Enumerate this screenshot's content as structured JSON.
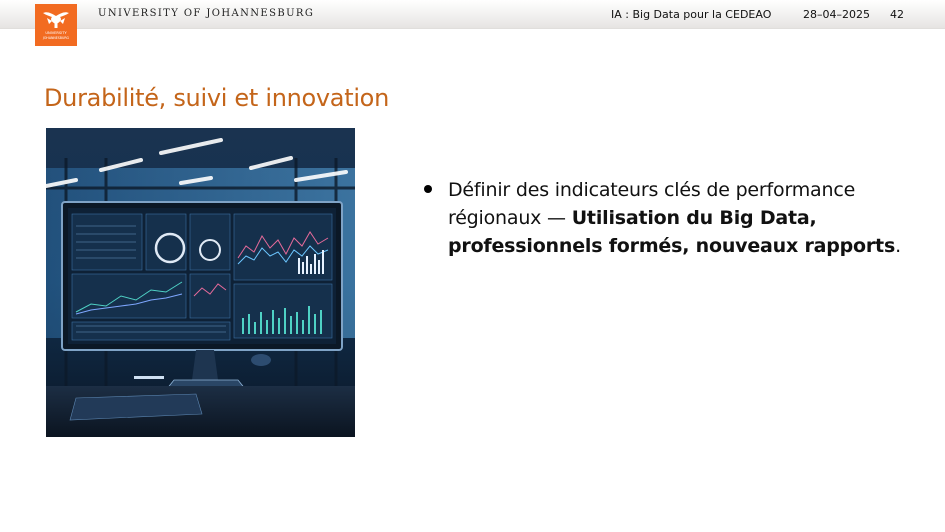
{
  "header": {
    "logo_line1": "UNIVERSITY",
    "logo_line2": "JOHANNESBURG",
    "university": "UNIVERSITY OF JOHANNESBURG",
    "course": "IA : Big Data pour la CEDEAO",
    "date": "28–04–2025",
    "page_number": "42"
  },
  "slide": {
    "title": "Durabilité, suivi et innovation",
    "bullet": {
      "text_before": "Définir des indicateurs clés de performance régionaux — ",
      "bold": "Utilisation du Big Data, professionnels formés, nouveaux rapports",
      "text_after": "."
    }
  },
  "colors": {
    "accent": "#c4651a",
    "logo_bg": "#f26b21"
  }
}
